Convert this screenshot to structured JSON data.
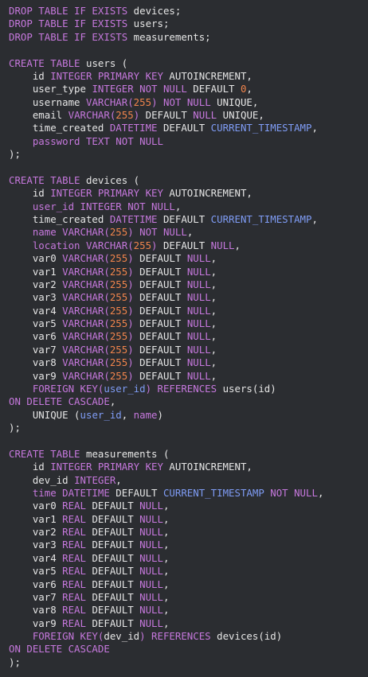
{
  "code": {
    "lines": [
      [
        [
          "k",
          "DROP TABLE IF EXISTS "
        ],
        [
          "i",
          "devices;"
        ]
      ],
      [
        [
          "k",
          "DROP TABLE IF EXISTS "
        ],
        [
          "i",
          "users;"
        ]
      ],
      [
        [
          "k",
          "DROP TABLE IF EXISTS "
        ],
        [
          "i",
          "measurements;"
        ]
      ],
      [],
      [
        [
          "k",
          "CREATE TABLE "
        ],
        [
          "i",
          "users ("
        ]
      ],
      [
        [
          "i",
          "    id "
        ],
        [
          "k",
          "INTEGER PRIMARY KEY "
        ],
        [
          "i",
          "AUTOINCREMENT,"
        ]
      ],
      [
        [
          "i",
          "    user_type "
        ],
        [
          "k",
          "INTEGER NOT NULL "
        ],
        [
          "i",
          "DEFAULT "
        ],
        [
          "n",
          "0"
        ],
        [
          "i",
          ","
        ]
      ],
      [
        [
          "i",
          "    username "
        ],
        [
          "k",
          "VARCHAR("
        ],
        [
          "n",
          "255"
        ],
        [
          "k",
          ") NOT NULL "
        ],
        [
          "i",
          "UNIQUE,"
        ]
      ],
      [
        [
          "i",
          "    email "
        ],
        [
          "k",
          "VARCHAR("
        ],
        [
          "n",
          "255"
        ],
        [
          "k",
          ") "
        ],
        [
          "i",
          "DEFAULT "
        ],
        [
          "k",
          "NULL "
        ],
        [
          "i",
          "UNIQUE,"
        ]
      ],
      [
        [
          "i",
          "    time_created "
        ],
        [
          "k",
          "DATETIME "
        ],
        [
          "i",
          "DEFAULT "
        ],
        [
          "b",
          "CURRENT_TIMESTAMP"
        ],
        [
          "i",
          ","
        ]
      ],
      [
        [
          "k",
          "    password TEXT NOT NULL"
        ]
      ],
      [
        [
          "i",
          ");"
        ]
      ],
      [],
      [
        [
          "k",
          "CREATE TABLE "
        ],
        [
          "i",
          "devices ("
        ]
      ],
      [
        [
          "i",
          "    id "
        ],
        [
          "k",
          "INTEGER PRIMARY KEY "
        ],
        [
          "i",
          "AUTOINCREMENT,"
        ]
      ],
      [
        [
          "k",
          "    user_id INTEGER NOT NULL"
        ],
        [
          "i",
          ","
        ]
      ],
      [
        [
          "i",
          "    time_created "
        ],
        [
          "k",
          "DATETIME "
        ],
        [
          "i",
          "DEFAULT "
        ],
        [
          "b",
          "CURRENT_TIMESTAMP"
        ],
        [
          "i",
          ","
        ]
      ],
      [
        [
          "k",
          "    name VARCHAR("
        ],
        [
          "n",
          "255"
        ],
        [
          "k",
          ") NOT NULL"
        ],
        [
          "i",
          ","
        ]
      ],
      [
        [
          "k",
          "    location VARCHAR("
        ],
        [
          "n",
          "255"
        ],
        [
          "k",
          ") "
        ],
        [
          "i",
          "DEFAULT "
        ],
        [
          "k",
          "NULL"
        ],
        [
          "i",
          ","
        ]
      ],
      [
        [
          "i",
          "    var0 "
        ],
        [
          "k",
          "VARCHAR("
        ],
        [
          "n",
          "255"
        ],
        [
          "k",
          ") "
        ],
        [
          "i",
          "DEFAULT "
        ],
        [
          "k",
          "NULL"
        ],
        [
          "i",
          ","
        ]
      ],
      [
        [
          "i",
          "    var1 "
        ],
        [
          "k",
          "VARCHAR("
        ],
        [
          "n",
          "255"
        ],
        [
          "k",
          ") "
        ],
        [
          "i",
          "DEFAULT "
        ],
        [
          "k",
          "NULL"
        ],
        [
          "i",
          ","
        ]
      ],
      [
        [
          "i",
          "    var2 "
        ],
        [
          "k",
          "VARCHAR("
        ],
        [
          "n",
          "255"
        ],
        [
          "k",
          ") "
        ],
        [
          "i",
          "DEFAULT "
        ],
        [
          "k",
          "NULL"
        ],
        [
          "i",
          ","
        ]
      ],
      [
        [
          "i",
          "    var3 "
        ],
        [
          "k",
          "VARCHAR("
        ],
        [
          "n",
          "255"
        ],
        [
          "k",
          ") "
        ],
        [
          "i",
          "DEFAULT "
        ],
        [
          "k",
          "NULL"
        ],
        [
          "i",
          ","
        ]
      ],
      [
        [
          "i",
          "    var4 "
        ],
        [
          "k",
          "VARCHAR("
        ],
        [
          "n",
          "255"
        ],
        [
          "k",
          ") "
        ],
        [
          "i",
          "DEFAULT "
        ],
        [
          "k",
          "NULL"
        ],
        [
          "i",
          ","
        ]
      ],
      [
        [
          "i",
          "    var5 "
        ],
        [
          "k",
          "VARCHAR("
        ],
        [
          "n",
          "255"
        ],
        [
          "k",
          ") "
        ],
        [
          "i",
          "DEFAULT "
        ],
        [
          "k",
          "NULL"
        ],
        [
          "i",
          ","
        ]
      ],
      [
        [
          "i",
          "    var6 "
        ],
        [
          "k",
          "VARCHAR("
        ],
        [
          "n",
          "255"
        ],
        [
          "k",
          ") "
        ],
        [
          "i",
          "DEFAULT "
        ],
        [
          "k",
          "NULL"
        ],
        [
          "i",
          ","
        ]
      ],
      [
        [
          "i",
          "    var7 "
        ],
        [
          "k",
          "VARCHAR("
        ],
        [
          "n",
          "255"
        ],
        [
          "k",
          ") "
        ],
        [
          "i",
          "DEFAULT "
        ],
        [
          "k",
          "NULL"
        ],
        [
          "i",
          ","
        ]
      ],
      [
        [
          "i",
          "    var8 "
        ],
        [
          "k",
          "VARCHAR("
        ],
        [
          "n",
          "255"
        ],
        [
          "k",
          ") "
        ],
        [
          "i",
          "DEFAULT "
        ],
        [
          "k",
          "NULL"
        ],
        [
          "i",
          ","
        ]
      ],
      [
        [
          "i",
          "    var9 "
        ],
        [
          "k",
          "VARCHAR("
        ],
        [
          "n",
          "255"
        ],
        [
          "k",
          ") "
        ],
        [
          "i",
          "DEFAULT "
        ],
        [
          "k",
          "NULL"
        ],
        [
          "i",
          ","
        ]
      ],
      [
        [
          "k",
          "    FOREIGN KEY("
        ],
        [
          "b",
          "user_id"
        ],
        [
          "k",
          ") REFERENCES "
        ],
        [
          "i",
          "users(id)"
        ]
      ],
      [
        [
          "k",
          "ON DELETE CASCADE"
        ],
        [
          "i",
          ","
        ]
      ],
      [
        [
          "i",
          "    UNIQUE ("
        ],
        [
          "b",
          "user_id"
        ],
        [
          "i",
          ", "
        ],
        [
          "k",
          "name"
        ],
        [
          "i",
          ")"
        ]
      ],
      [
        [
          "i",
          ");"
        ]
      ],
      [],
      [
        [
          "k",
          "CREATE TABLE "
        ],
        [
          "i",
          "measurements ("
        ]
      ],
      [
        [
          "i",
          "    id "
        ],
        [
          "k",
          "INTEGER PRIMARY KEY "
        ],
        [
          "i",
          "AUTOINCREMENT,"
        ]
      ],
      [
        [
          "i",
          "    dev_id "
        ],
        [
          "k",
          "INTEGER"
        ],
        [
          "i",
          ","
        ]
      ],
      [
        [
          "k",
          "    time DATETIME "
        ],
        [
          "i",
          "DEFAULT "
        ],
        [
          "b",
          "CURRENT_TIMESTAMP "
        ],
        [
          "k",
          "NOT NULL"
        ],
        [
          "i",
          ","
        ]
      ],
      [
        [
          "i",
          "    var0 "
        ],
        [
          "k",
          "REAL "
        ],
        [
          "i",
          "DEFAULT "
        ],
        [
          "k",
          "NULL"
        ],
        [
          "i",
          ","
        ]
      ],
      [
        [
          "i",
          "    var1 "
        ],
        [
          "k",
          "REAL "
        ],
        [
          "i",
          "DEFAULT "
        ],
        [
          "k",
          "NULL"
        ],
        [
          "i",
          ","
        ]
      ],
      [
        [
          "i",
          "    var2 "
        ],
        [
          "k",
          "REAL "
        ],
        [
          "i",
          "DEFAULT "
        ],
        [
          "k",
          "NULL"
        ],
        [
          "i",
          ","
        ]
      ],
      [
        [
          "i",
          "    var3 "
        ],
        [
          "k",
          "REAL "
        ],
        [
          "i",
          "DEFAULT "
        ],
        [
          "k",
          "NULL"
        ],
        [
          "i",
          ","
        ]
      ],
      [
        [
          "i",
          "    var4 "
        ],
        [
          "k",
          "REAL "
        ],
        [
          "i",
          "DEFAULT "
        ],
        [
          "k",
          "NULL"
        ],
        [
          "i",
          ","
        ]
      ],
      [
        [
          "i",
          "    var5 "
        ],
        [
          "k",
          "REAL "
        ],
        [
          "i",
          "DEFAULT "
        ],
        [
          "k",
          "NULL"
        ],
        [
          "i",
          ","
        ]
      ],
      [
        [
          "i",
          "    var6 "
        ],
        [
          "k",
          "REAL "
        ],
        [
          "i",
          "DEFAULT "
        ],
        [
          "k",
          "NULL"
        ],
        [
          "i",
          ","
        ]
      ],
      [
        [
          "i",
          "    var7 "
        ],
        [
          "k",
          "REAL "
        ],
        [
          "i",
          "DEFAULT "
        ],
        [
          "k",
          "NULL"
        ],
        [
          "i",
          ","
        ]
      ],
      [
        [
          "i",
          "    var8 "
        ],
        [
          "k",
          "REAL "
        ],
        [
          "i",
          "DEFAULT "
        ],
        [
          "k",
          "NULL"
        ],
        [
          "i",
          ","
        ]
      ],
      [
        [
          "i",
          "    var9 "
        ],
        [
          "k",
          "REAL "
        ],
        [
          "i",
          "DEFAULT "
        ],
        [
          "k",
          "NULL"
        ],
        [
          "i",
          ","
        ]
      ],
      [
        [
          "k",
          "    FOREIGN KEY("
        ],
        [
          "i",
          "dev_id"
        ],
        [
          "k",
          ") REFERENCES "
        ],
        [
          "i",
          "devices(id)"
        ]
      ],
      [
        [
          "k",
          "ON DELETE CASCADE"
        ]
      ],
      [
        [
          "i",
          ");"
        ]
      ]
    ]
  },
  "colors": {
    "background": "#2b2d31",
    "keyword": "#c678dd",
    "identifier": "#e6e6e6",
    "number": "#f0844c",
    "builtin": "#7f9cf5"
  }
}
